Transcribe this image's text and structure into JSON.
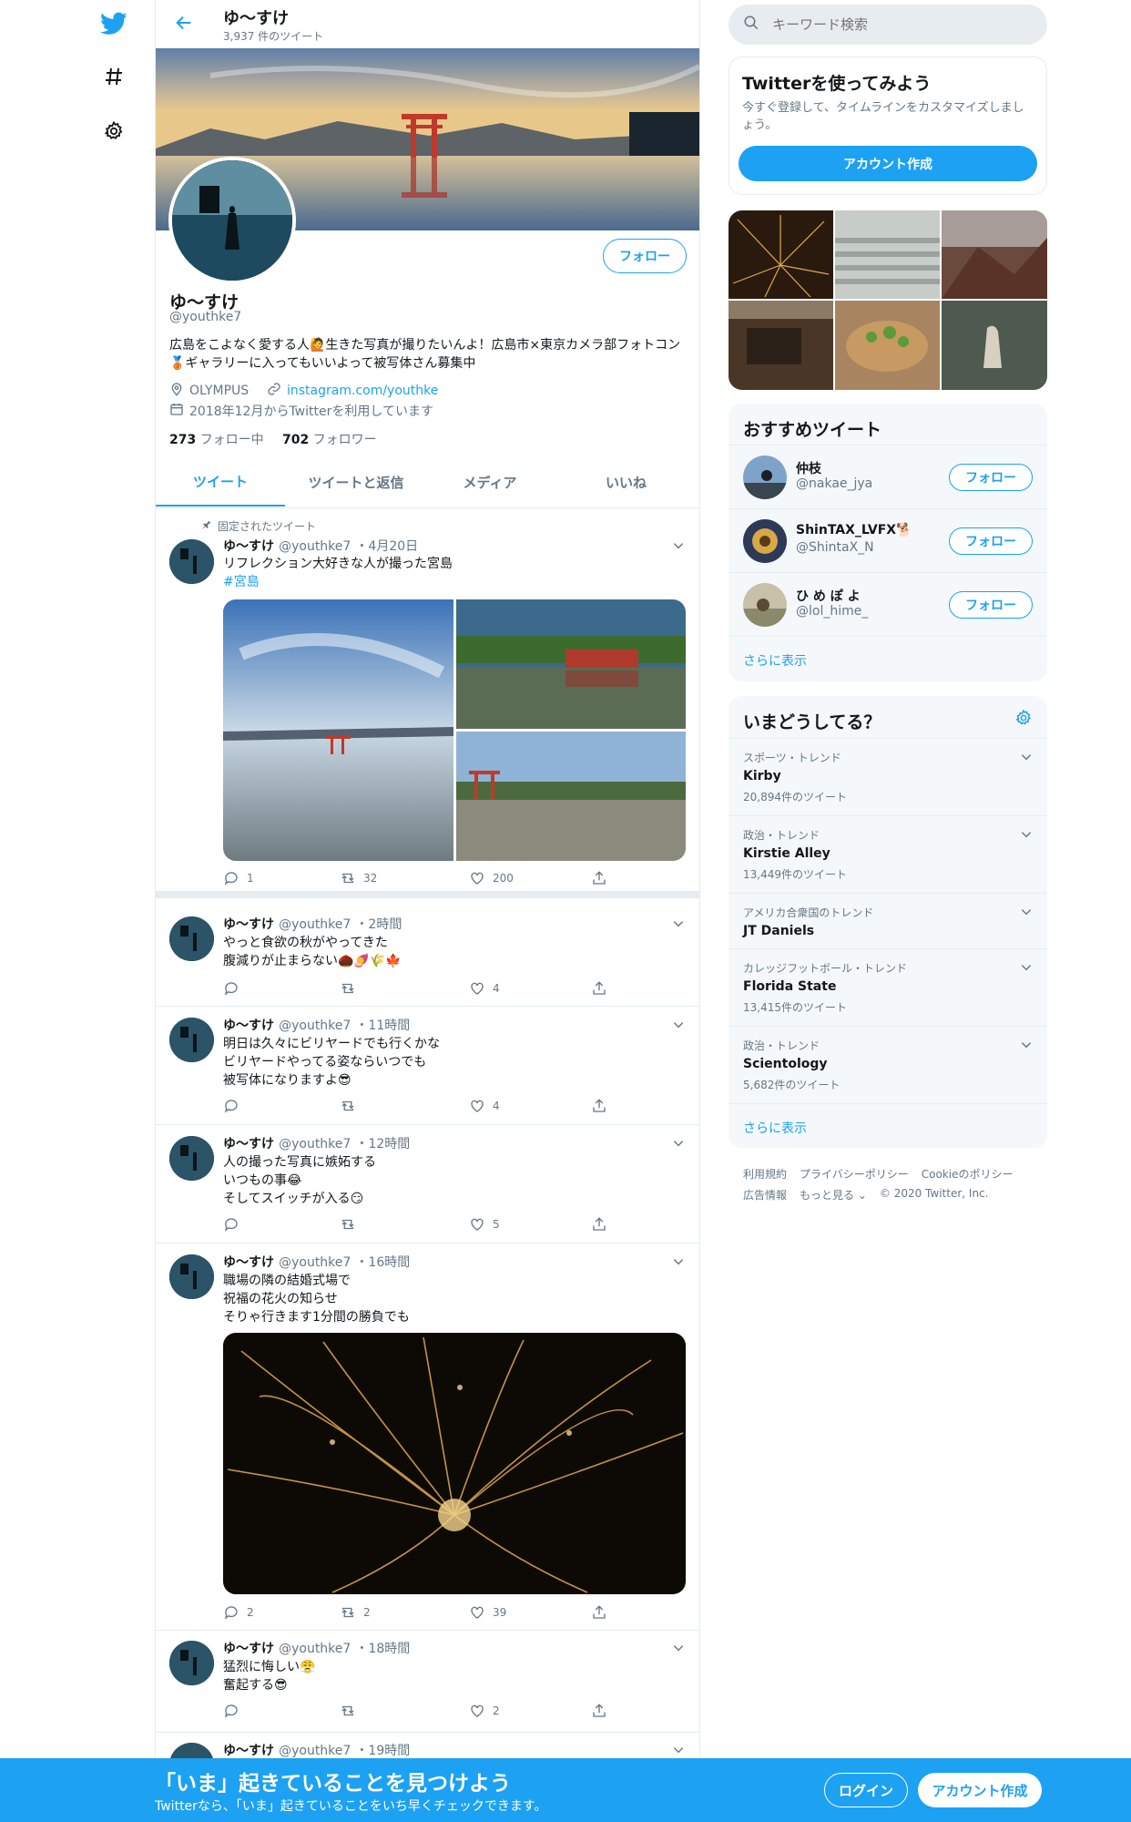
{
  "profile": {
    "name": "ゆ〜すけ",
    "tweet_count": "3,937 件のツイート",
    "handle": "@youthke7",
    "bio": "広島をこよなく愛する人🙋生きた写真が撮りたいんよ！広島市×東京カメラ部フォトコン🥉ギャラリーに入ってもいいよって被写体さん募集中",
    "location": "OLYMPUS",
    "website": "instagram.com/youthke",
    "joined": "2018年12月からTwitterを利用しています",
    "following_count": "273",
    "following_label": "フォロー中",
    "followers_count": "702",
    "followers_label": "フォロワー",
    "follow_label": "フォロー"
  },
  "tabs": [
    "ツイート",
    "ツイートと返信",
    "メディア",
    "いいね"
  ],
  "pinned_label": "固定されたツイート",
  "tweets": [
    {
      "name": "ゆ〜すけ",
      "handle": "@youthke7",
      "time": "・4月20日",
      "text": "リフレクション大好きな人が撮った宮島",
      "hashtag": "#宮島",
      "reply": "1",
      "retweet": "32",
      "like": "200"
    },
    {
      "name": "ゆ〜すけ",
      "handle": "@youthke7",
      "time": "・2時間",
      "text": "やっと食欲の秋がやってきた\n腹減りが止まらない🌰🍠🌾🍁",
      "reply": "",
      "retweet": "",
      "like": "4"
    },
    {
      "name": "ゆ〜すけ",
      "handle": "@youthke7",
      "time": "・11時間",
      "text": "明日は久々にビリヤードでも行くかな\nビリヤードやってる姿ならいつでも\n被写体になりますよ😎",
      "reply": "",
      "retweet": "",
      "like": "4"
    },
    {
      "name": "ゆ〜すけ",
      "handle": "@youthke7",
      "time": "・12時間",
      "text": "人の撮った写真に嫉妬する\nいつもの事😂\nそしてスイッチが入る😏",
      "reply": "",
      "retweet": "",
      "like": "5"
    },
    {
      "name": "ゆ〜すけ",
      "handle": "@youthke7",
      "time": "・16時間",
      "text": "職場の隣の結婚式場で\n祝福の花火の知らせ\nそりゃ行きます1分間の勝負でも",
      "reply": "2",
      "retweet": "2",
      "like": "39"
    },
    {
      "name": "ゆ〜すけ",
      "handle": "@youthke7",
      "time": "・18時間",
      "text": "猛烈に悔しい😤\n奮起する😎",
      "reply": "",
      "retweet": "",
      "like": "2"
    },
    {
      "name": "ゆ〜すけ",
      "handle": "@youthke7",
      "time": "・19時間",
      "text": ""
    }
  ],
  "search": {
    "placeholder": "キーワード検索"
  },
  "signup_card": {
    "title": "Twitterを使ってみよう",
    "body": "今すぐ登録して、タイムラインをカスタマイズしましょう。",
    "button": "アカウント作成"
  },
  "suggested": {
    "title": "おすすめツイート",
    "users": [
      {
        "name": "仲枝",
        "handle": "@nakae_jya"
      },
      {
        "name": "ShinTAX_LVFX🐕",
        "handle": "@ShintaX_N"
      },
      {
        "name": "ひ め ぽ よ",
        "handle": "@lol_hime_"
      }
    ],
    "follow_label": "フォロー",
    "more": "さらに表示"
  },
  "trends": {
    "title": "いまどうしてる？",
    "items": [
      {
        "category": "スポーツ・トレンド",
        "name": "Kirby",
        "count": "20,894件のツイート"
      },
      {
        "category": "政治・トレンド",
        "name": "Kirstie Alley",
        "count": "13,449件のツイート"
      },
      {
        "category": "アメリカ合衆国のトレンド",
        "name": "JT Daniels",
        "count": ""
      },
      {
        "category": "カレッジフットボール・トレンド",
        "name": "Florida State",
        "count": "13,415件のツイート"
      },
      {
        "category": "政治・トレンド",
        "name": "Scientology",
        "count": "5,682件のツイート"
      }
    ],
    "more": "さらに表示"
  },
  "footer": {
    "links1": [
      "利用規約",
      "プライバシーポリシー",
      "Cookieのポリシー"
    ],
    "links2": [
      "広告情報",
      "もっと見る ⌄",
      "© 2020 Twitter, Inc."
    ]
  },
  "bottom_bar": {
    "title": "「いま」起きていることを見つけよう",
    "subtitle": "Twitterなら、「いま」起きていることをいち早くチェックできます。",
    "login": "ログイン",
    "signup": "アカウント作成"
  },
  "colors": {
    "accent": "#1da1f2",
    "bg_card": "#f5f8fa",
    "border": "#e6ecf0"
  }
}
